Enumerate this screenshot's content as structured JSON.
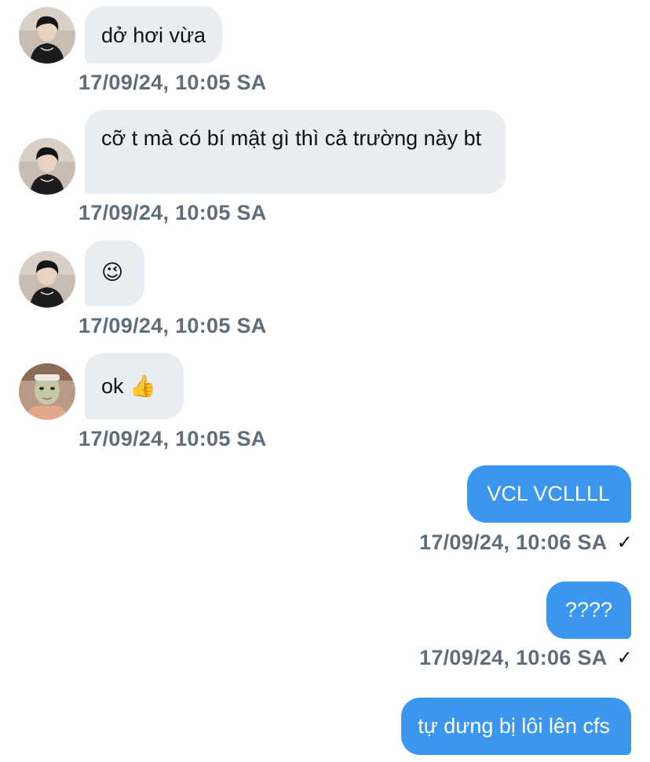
{
  "messages": [
    {
      "direction": "in",
      "text": "dở hơi vừa",
      "timestamp": "17/09/24, 10:05 SA"
    },
    {
      "direction": "in",
      "text": "cỡ t mà có bí mật gì thì cả trường này bt",
      "timestamp": "17/09/24, 10:05 SA"
    },
    {
      "direction": "in",
      "text": "😉",
      "timestamp": "17/09/24, 10:05 SA"
    },
    {
      "direction": "in",
      "text": "ok 👍",
      "timestamp": "17/09/24, 10:05 SA"
    },
    {
      "direction": "out",
      "text": "VCL VCLLLL",
      "timestamp": "17/09/24, 10:06 SA",
      "status_icon": "✓"
    },
    {
      "direction": "out",
      "text": "????",
      "timestamp": "17/09/24, 10:06 SA",
      "status_icon": "✓"
    },
    {
      "direction": "out",
      "text": "tự dưng bị lôi lên cfs"
    }
  ],
  "colors": {
    "incoming_bubble": "#e9edf1",
    "outgoing_bubble": "#3b96ef",
    "timestamp": "#5f6d7a"
  },
  "icons": {
    "avatar_a": "user-avatar-dark-hair",
    "avatar_b": "user-avatar-face-mask",
    "read_status": "checkmark-icon"
  }
}
